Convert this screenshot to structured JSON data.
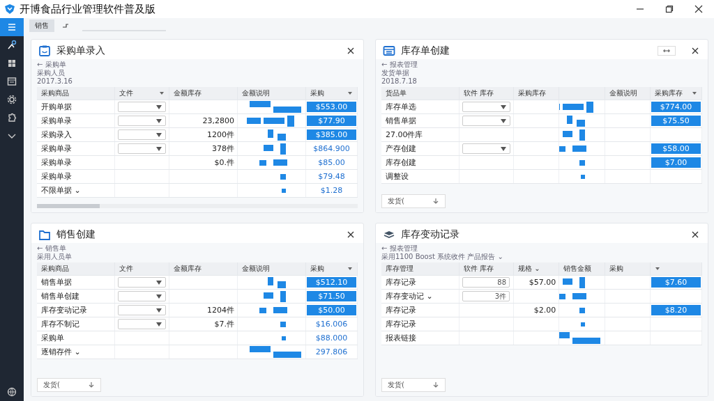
{
  "window": {
    "title": "开博食品行业管理软件普及版"
  },
  "sidebar": {
    "items": [
      {
        "selected": true
      },
      {
        "selected": false
      },
      {
        "selected": false
      },
      {
        "selected": false
      },
      {
        "selected": false
      },
      {
        "selected": false
      },
      {
        "selected": false
      }
    ]
  },
  "tabs": [
    {
      "label": "销售",
      "selected": true
    },
    {
      "selected": false
    }
  ],
  "panels": [
    {
      "title": "采购单录入",
      "sublines": [
        "← 采购单",
        "采购人员",
        "2017.3.16"
      ],
      "columns": [
        {
          "label": "采购商品"
        },
        {
          "label": "文件",
          "sort": true
        },
        {
          "label": "金额库存"
        },
        {
          "label": "金额说明"
        },
        {
          "label": "采购",
          "sort": true
        }
      ],
      "rows": [
        {
          "name": "开购单据",
          "kind": "dropdown",
          "amount": "$553.00",
          "highlighted": true
        },
        {
          "name": "采购单录",
          "kind": "dropdown",
          "qty": "23,2800",
          "amount": "$77.90",
          "highlighted": true
        },
        {
          "name": "采购录入",
          "kind": "dropdown",
          "qty": "1200件",
          "amount": "$385.00",
          "highlighted": true
        },
        {
          "name": "采购单录",
          "kind": "dropdown",
          "qty": "378件",
          "amount": "$864.900",
          "highlighted": false
        },
        {
          "name": "采购单录",
          "kind": "plain",
          "qty": "$0.件",
          "amount": "$85.00",
          "highlighted": false
        },
        {
          "name": "采购单录",
          "kind": "plain",
          "amount": "$79.48",
          "highlighted": false
        },
        {
          "name": "不限单据 ⌄",
          "kind": "plain",
          "amount": "$1.28",
          "highlighted": false
        }
      ]
    },
    {
      "title": "库存单创建",
      "pin": true,
      "sublines": [
        "← 报表管理",
        "发货单据",
        "2018.7.18"
      ],
      "columns": [
        {
          "label": "货品单"
        },
        {
          "label": "软件 库存"
        },
        {
          "label": "采购库存"
        },
        {},
        {
          "label": "金额说明"
        },
        {
          "label": "采购库存",
          "sort": true
        }
      ],
      "rows": [
        {
          "name": "库存单选",
          "kind": "dropdown",
          "amount": "$774.00",
          "highlighted": true
        },
        {
          "name": "销售单据",
          "kind": "dropdown",
          "amount": "$75.50",
          "highlighted": true
        },
        {
          "name": "27.00件库",
          "kind": "plain"
        },
        {
          "name": "产存创建",
          "kind": "dropdown",
          "amount": "$58.00",
          "highlighted": true
        },
        {
          "name": "库存创建",
          "kind": "plain",
          "amount": "$7.00",
          "highlighted": true
        },
        {
          "name": "调整设",
          "kind": "plain"
        }
      ],
      "footer_button": "发货("
    },
    {
      "title": "销售创建",
      "sublines": [
        "← 销售单",
        "采用人员单"
      ],
      "columns": [
        {
          "label": "采购商品"
        },
        {
          "label": "文件"
        },
        {
          "label": "金额库存"
        },
        {
          "label": "金额说明"
        },
        {
          "label": "采购",
          "sort": true
        }
      ],
      "rows": [
        {
          "name": "销售单据",
          "kind": "dropdown",
          "amount": "$512.10",
          "highlighted": true
        },
        {
          "name": "销售单创建",
          "kind": "dropdown",
          "amount": "$71.50",
          "highlighted": true
        },
        {
          "name": "库存变动记录",
          "kind": "dropdown",
          "qty": "1204件",
          "amount": "$50.00",
          "highlighted": true
        },
        {
          "name": "库存不制记",
          "kind": "dropdown",
          "qty": "$7.件",
          "amount": "$16.006",
          "highlighted": false
        },
        {
          "name": "采购单",
          "kind": "plain",
          "amount": "$88.000",
          "highlighted": false
        },
        {
          "name": "逐销存件 ⌄",
          "kind": "plain",
          "amount": "297.806",
          "highlighted": false
        }
      ],
      "footer_button": "发货("
    },
    {
      "title": "库存变动记录",
      "sublines": [
        "← 报表管理",
        "采用1100 Boost 系统收件 产品报告 ⌄"
      ],
      "columns": [
        {
          "label": "库存管理"
        },
        {
          "label": "软件 库存"
        },
        {
          "label": "规格 ⌄"
        },
        {
          "label": "销售金额"
        },
        {
          "label": "采购"
        },
        {
          "sort": true
        }
      ],
      "rows": [
        {
          "name": "库存记录",
          "kind": "field",
          "value": "88",
          "qty": "$57.00",
          "amount": "$7.60",
          "highlighted": true
        },
        {
          "name": "库存变动记 ⌄",
          "kind": "field",
          "value": "3件"
        },
        {
          "name": "库存记录",
          "kind": "plain",
          "qty": "$2.00",
          "amount": "$8.20",
          "highlighted": true
        },
        {
          "name": "库存记录",
          "kind": "plain"
        },
        {
          "name": "报表链接",
          "kind": "plain"
        }
      ],
      "footer_button": "发货("
    }
  ]
}
